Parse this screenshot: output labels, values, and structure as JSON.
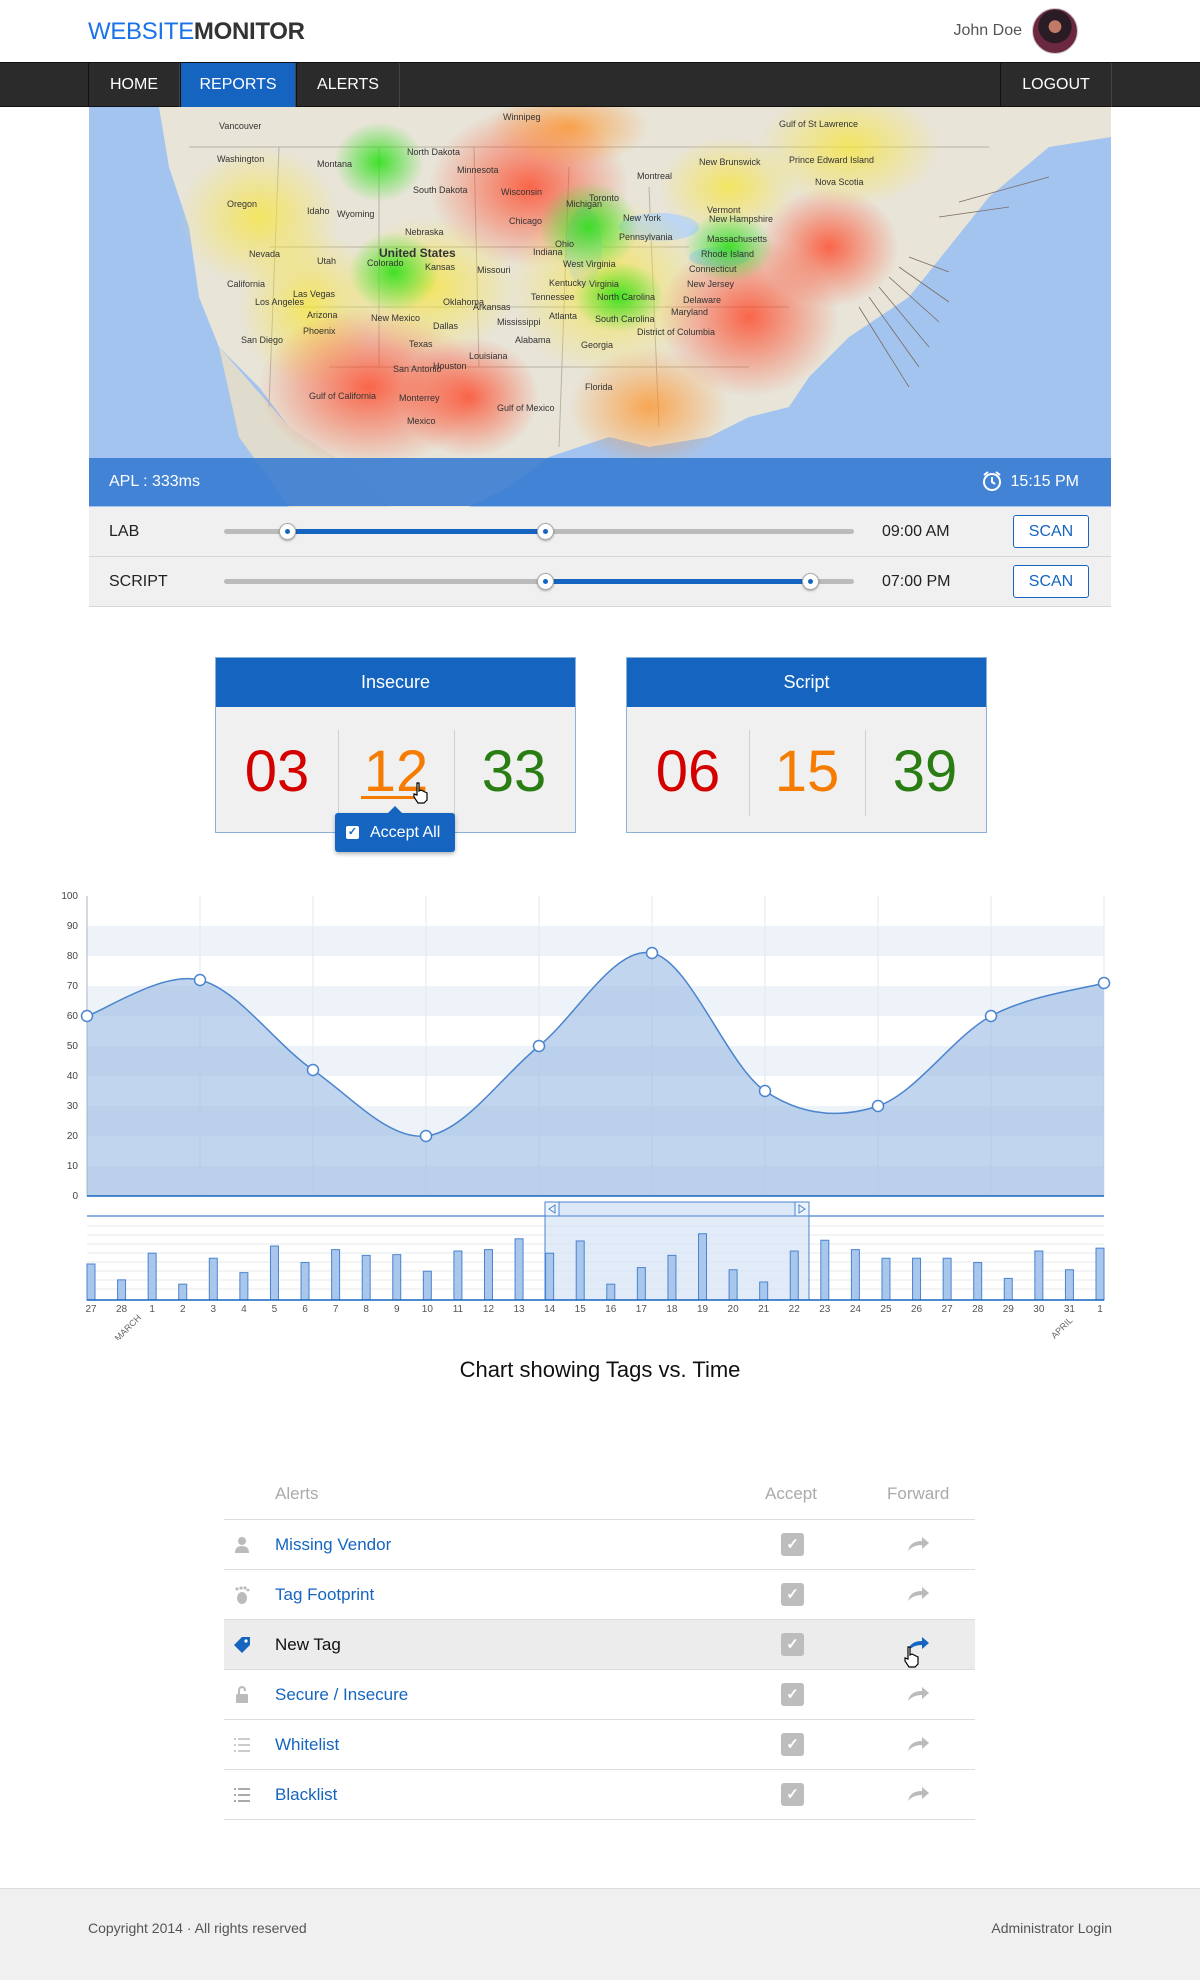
{
  "header": {
    "logo_part1": "WEBSITE",
    "logo_part2": "MONITOR",
    "user_name": "John Doe"
  },
  "nav": {
    "items": [
      {
        "label": "HOME"
      },
      {
        "label": "REPORTS",
        "active": true
      },
      {
        "label": "ALERTS"
      }
    ],
    "logout": "LOGOUT"
  },
  "map": {
    "labels": [
      "Vancouver",
      "Washington",
      "Montana",
      "North Dakota",
      "Minnesota",
      "Winnipeg",
      "Oregon",
      "Idaho",
      "Wyoming",
      "South Dakota",
      "Wisconsin",
      "Michigan",
      "Toronto",
      "Montreal",
      "New Brunswick",
      "Prince Edward Island",
      "Nova Scotia",
      "Gulf of St Lawrence",
      "Nevada",
      "Nebraska",
      "United States",
      "Chicago",
      "Ohio",
      "New York",
      "Vermont",
      "New Hampshire",
      "Massachusetts",
      "Rhode Island",
      "Connecticut",
      "New Jersey",
      "Delaware",
      "Maryland",
      "District of Columbia",
      "California",
      "Utah",
      "Colorado",
      "Kansas",
      "Missouri",
      "Indiana",
      "Pennsylvania",
      "West Virginia",
      "Virginia",
      "Kentucky",
      "Las Vegas",
      "Los Angeles",
      "San Diego",
      "Arizona",
      "Phoenix",
      "New Mexico",
      "Oklahoma",
      "Arkansas",
      "Tennessee",
      "North Carolina",
      "South Carolina",
      "Atlanta",
      "Dallas",
      "Mississippi",
      "Alabama",
      "Georgia",
      "Texas",
      "San Antonio",
      "Houston",
      "Louisiana",
      "Gulf of California",
      "Monterrey",
      "Gulf of Mexico",
      "Florida",
      "Mexico"
    ],
    "apl_label": "APL : 333ms",
    "time": "15:15 PM"
  },
  "scans": [
    {
      "label": "LAB",
      "time": "09:00 AM",
      "button": "SCAN",
      "range": [
        0.1,
        0.51
      ]
    },
    {
      "label": "SCRIPT",
      "time": "07:00 PM",
      "button": "SCAN",
      "range": [
        0.51,
        0.93
      ]
    }
  ],
  "stats": [
    {
      "title": "Insecure",
      "values": [
        "03",
        "12",
        "33"
      ]
    },
    {
      "title": "Script",
      "values": [
        "06",
        "15",
        "39"
      ]
    }
  ],
  "accept_all": "Accept All",
  "chart_data": {
    "type": "area",
    "ylim": [
      0,
      100
    ],
    "yticks": [
      "0",
      "10",
      "20",
      "30",
      "40",
      "50",
      "60",
      "70",
      "80",
      "90",
      "100"
    ],
    "points": [
      60,
      72,
      42,
      20,
      50,
      81,
      35,
      30,
      60,
      71
    ],
    "mini": {
      "type": "bar",
      "categories": [
        "27",
        "28",
        "1",
        "2",
        "3",
        "4",
        "5",
        "6",
        "7",
        "8",
        "9",
        "10",
        "11",
        "12",
        "13",
        "14",
        "15",
        "16",
        "17",
        "18",
        "19",
        "20",
        "21",
        "22",
        "23",
        "24",
        "25",
        "26",
        "27",
        "28",
        "29",
        "30",
        "31",
        "1"
      ],
      "values": [
        50,
        28,
        65,
        22,
        58,
        38,
        75,
        52,
        70,
        62,
        63,
        40,
        68,
        70,
        85,
        65,
        82,
        22,
        45,
        62,
        92,
        42,
        25,
        68,
        83,
        70,
        58,
        58,
        58,
        52,
        30,
        68,
        42,
        72
      ],
      "month_labels": [
        "MARCH",
        "APRIL"
      ]
    },
    "title": "Chart showing Tags vs. Time"
  },
  "alerts": {
    "headers": {
      "name": "Alerts",
      "accept": "Accept",
      "forward": "Forward"
    },
    "rows": [
      {
        "label": "Missing Vendor",
        "icon": "user-icon"
      },
      {
        "label": "Tag Footprint",
        "icon": "footprint-icon"
      },
      {
        "label": "New Tag",
        "icon": "tag-icon",
        "selected": true
      },
      {
        "label": "Secure / Insecure",
        "icon": "lock-icon"
      },
      {
        "label": "Whitelist",
        "icon": "list-icon"
      },
      {
        "label": "Blacklist",
        "icon": "list-icon"
      }
    ]
  },
  "footer": {
    "copyright": "Copyright 2014 · All rights reserved",
    "admin": "Administrator Login"
  }
}
